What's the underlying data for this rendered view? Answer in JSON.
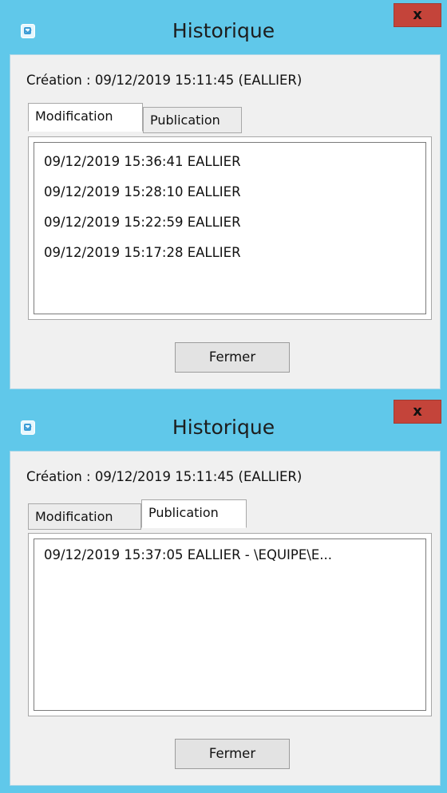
{
  "dialogs": [
    {
      "title": "Historique",
      "close_label": "x",
      "creation": "Création : 09/12/2019 15:11:45 (EALLIER)",
      "tabs": [
        {
          "label": "Modification",
          "active": true
        },
        {
          "label": "Publication",
          "active": false
        }
      ],
      "items": [
        "09/12/2019 15:36:41 EALLIER",
        "09/12/2019 15:28:10 EALLIER",
        "09/12/2019 15:22:59 EALLIER",
        "09/12/2019 15:17:28 EALLIER"
      ],
      "close_button": "Fermer"
    },
    {
      "title": "Historique",
      "close_label": "x",
      "creation": "Création : 09/12/2019 15:11:45 (EALLIER)",
      "tabs": [
        {
          "label": "Modification",
          "active": false
        },
        {
          "label": "Publication",
          "active": true
        }
      ],
      "items": [
        "09/12/2019 15:37:05 EALLIER - \\EQUIPE\\E..."
      ],
      "close_button": "Fermer"
    }
  ],
  "colors": {
    "titlebar": "#60c8ea",
    "close_button": "#c4443a",
    "client_background": "#f0f0f0"
  },
  "icons": {
    "app": "app-icon",
    "close": "close-icon"
  }
}
